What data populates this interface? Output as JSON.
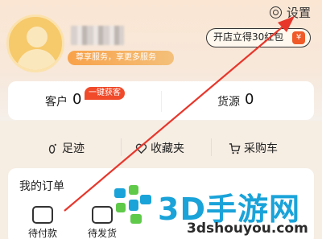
{
  "header": {
    "settings_label": "设置",
    "settings_icon": "gear-icon"
  },
  "profile": {
    "vip_tag": "尊享服务，享更多服务",
    "shop_button": "开店立得30红包",
    "gift_icon_text": "¥"
  },
  "stats": {
    "customers": {
      "label": "客户",
      "value": "0",
      "badge": "一键获客"
    },
    "supply": {
      "label": "货源",
      "value": "0"
    }
  },
  "quick_links": [
    {
      "label": "足迹",
      "icon": "footprint-icon"
    },
    {
      "label": "收藏夹",
      "icon": "heart-icon"
    },
    {
      "label": "采购车",
      "icon": "cart-icon"
    }
  ],
  "orders": {
    "title": "我的订单",
    "items": [
      {
        "label": "待付款",
        "icon": "wallet-icon"
      },
      {
        "label": "待发货",
        "icon": "package-icon"
      }
    ]
  },
  "watermark": {
    "main": "3D手游网",
    "sub": "3dshouyou.com"
  },
  "colors": {
    "accent_red": "#f04a2a",
    "annotation_arrow": "#e8362b",
    "watermark_blue": "#1aa3d9"
  }
}
